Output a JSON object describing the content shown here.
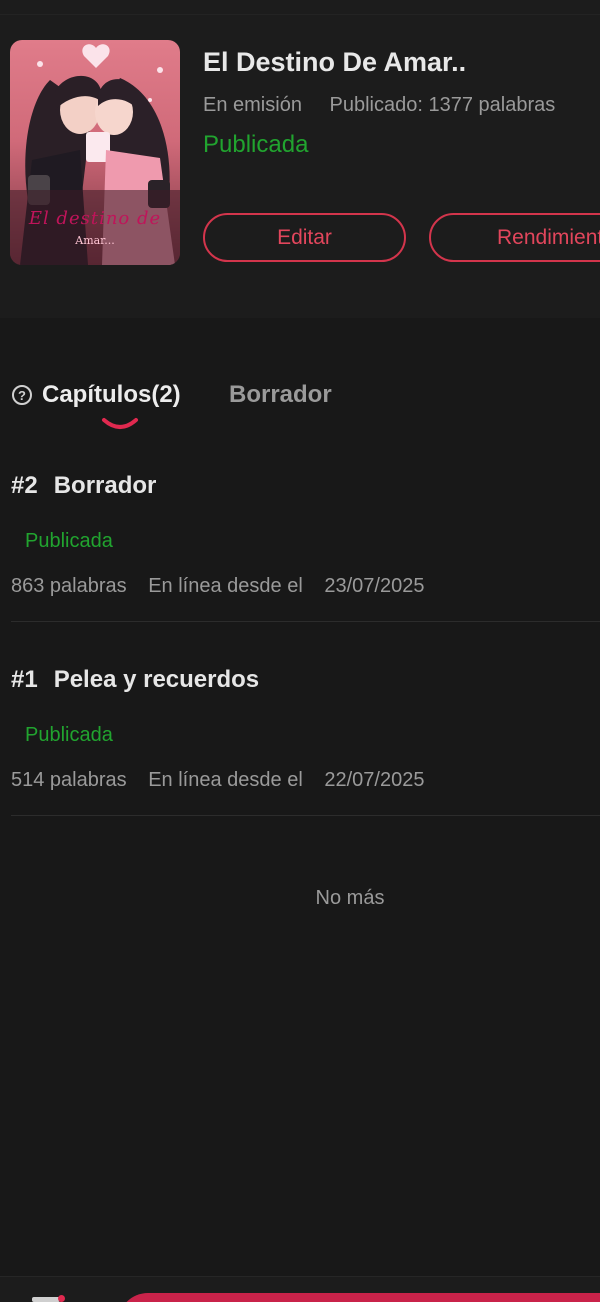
{
  "book": {
    "cover_title": "El destino de",
    "cover_subtitle": "Amar...",
    "title": "El Destino De Amar..",
    "serial_status": "En emisión",
    "published_words": "Publicado: 1377 palabras",
    "status": "Publicada",
    "edit_label": "Editar",
    "performance_label": "Rendimiento"
  },
  "tabs": {
    "chapters_label": "Capítulos(2)",
    "draft_label": "Borrador"
  },
  "chapters": [
    {
      "number": "#2",
      "title": "Borrador",
      "status": "Publicada",
      "words": "863 palabras",
      "online_label": "En línea desde el",
      "date": "23/07/2025"
    },
    {
      "number": "#1",
      "title": "Pelea y recuerdos",
      "status": "Publicada",
      "words": "514 palabras",
      "online_label": "En línea desde el",
      "date": "22/07/2025"
    }
  ],
  "footer": {
    "no_more": "No más"
  },
  "colors": {
    "background": "#181818",
    "accent": "#d3354c",
    "published_green": "#21a42f"
  },
  "icons": {
    "help": "help-circle-icon",
    "tab_indicator": "smile-curve-indicator"
  }
}
